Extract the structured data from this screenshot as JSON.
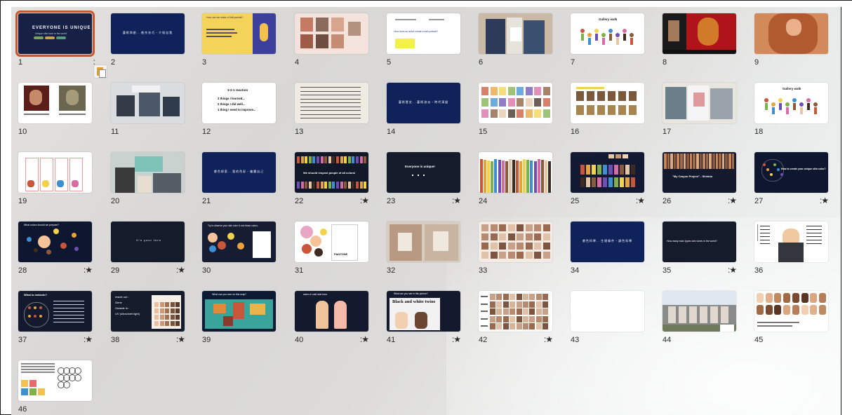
{
  "app": {
    "name": "Keynote slide navigator (light table)"
  },
  "colors": {
    "selection": "#c8572c",
    "navy": "#0f2259",
    "dark": "#111827",
    "number_text": "#2a2a2a"
  },
  "skipped_icon": "★",
  "slides": [
    {
      "n": "1",
      "title": "EVERYONE IS UNIQUE",
      "sub": "Unique skin tone in the world",
      "selected": true
    },
    {
      "n": "2",
      "title": "藝術與創...創作技巧・介紹自我"
    },
    {
      "n": "3",
      "title": "How can we make a Self portrait?"
    },
    {
      "n": "4"
    },
    {
      "n": "5",
      "title": "How does an artist create a self-portrait?"
    },
    {
      "n": "6"
    },
    {
      "n": "7",
      "title": "Gallery walk"
    },
    {
      "n": "8"
    },
    {
      "n": "9"
    },
    {
      "n": "10"
    },
    {
      "n": "11"
    },
    {
      "n": "12",
      "title": "3-2-1 reaction",
      "lines": [
        "3 things I learned...",
        "2 things I did well...",
        "1 thing I need to improve..."
      ]
    },
    {
      "n": "13"
    },
    {
      "n": "14",
      "title": "藝術歷史...藝術流派・時代演變"
    },
    {
      "n": "15"
    },
    {
      "n": "16"
    },
    {
      "n": "17"
    },
    {
      "n": "18",
      "title": "Gallery walk"
    },
    {
      "n": "19"
    },
    {
      "n": "20"
    },
    {
      "n": "21",
      "title": "膚色探索...我的色彩・繪畫自己"
    },
    {
      "n": "22",
      "title": "We should respect people of all colors!",
      "skipped": true
    },
    {
      "n": "23",
      "title": "Everyone is unique!",
      "skipped": true
    },
    {
      "n": "24"
    },
    {
      "n": "25",
      "skipped": true
    },
    {
      "n": "26",
      "title": "\"My Crayon Project\" - Shinido",
      "skipped": true
    },
    {
      "n": "27",
      "title": "How to create your unique skin color?",
      "skipped": true
    },
    {
      "n": "28",
      "title": "What colors should we prepare?",
      "skipped": true
    },
    {
      "n": "29",
      "title": "It's your turn",
      "skipped": true
    },
    {
      "n": "30",
      "title": "Try to observe your skin color & mix these colors."
    },
    {
      "n": "31",
      "title": "PANTONE"
    },
    {
      "n": "32"
    },
    {
      "n": "33"
    },
    {
      "n": "34",
      "title": "膚色科學...生理條件・調色科學"
    },
    {
      "n": "35",
      "title": "How many main types skin tones in the world?",
      "skipped": true
    },
    {
      "n": "36"
    },
    {
      "n": "37",
      "title": "What is melanin?",
      "skipped": true
    },
    {
      "n": "38",
      "lines": [
        "Inside out :",
        "Gene",
        "Outside in :",
        "UV (ultraviolet light)"
      ],
      "skipped": true
    },
    {
      "n": "39",
      "title": "What can you see on this map?"
    },
    {
      "n": "40",
      "title": "warm & cold skin tone",
      "skipped": true
    },
    {
      "n": "41",
      "title": "What can you see in this picture?",
      "sub": "Black and white twins",
      "skipped": true
    },
    {
      "n": "42",
      "skipped": true
    },
    {
      "n": "43"
    },
    {
      "n": "44"
    },
    {
      "n": "45"
    },
    {
      "n": "46"
    }
  ]
}
